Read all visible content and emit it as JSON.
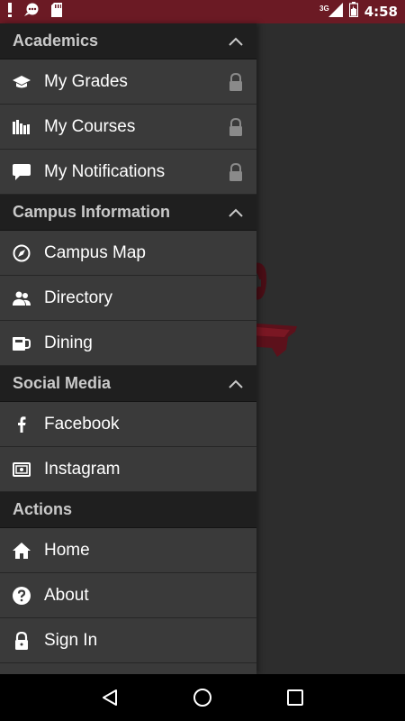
{
  "status_bar": {
    "time": "4:58",
    "network": "3G",
    "icons": [
      "alert-icon",
      "chat-icon",
      "sd-card-icon",
      "signal-icon",
      "battery-icon"
    ]
  },
  "drawer": {
    "sections": [
      {
        "title": "Academics",
        "collapsible": true,
        "items": [
          {
            "label": "My Grades",
            "icon": "graduation-cap-icon",
            "locked": true
          },
          {
            "label": "My Courses",
            "icon": "books-icon",
            "locked": true
          },
          {
            "label": "My Notifications",
            "icon": "speech-bubble-icon",
            "locked": true
          }
        ]
      },
      {
        "title": "Campus Information",
        "collapsible": true,
        "items": [
          {
            "label": "Campus Map",
            "icon": "compass-icon",
            "locked": false
          },
          {
            "label": "Directory",
            "icon": "people-icon",
            "locked": false
          },
          {
            "label": "Dining",
            "icon": "coffee-mug-icon",
            "locked": false
          }
        ]
      },
      {
        "title": "Social Media",
        "collapsible": true,
        "items": [
          {
            "label": "Facebook",
            "icon": "facebook-icon",
            "locked": false
          },
          {
            "label": "Instagram",
            "icon": "instagram-icon",
            "locked": false
          }
        ]
      },
      {
        "title": "Actions",
        "collapsible": false,
        "items": [
          {
            "label": "Home",
            "icon": "home-icon",
            "locked": false
          },
          {
            "label": "About",
            "icon": "help-circle-icon",
            "locked": false
          },
          {
            "label": "Sign In",
            "icon": "padlock-icon",
            "locked": false
          }
        ]
      }
    ]
  },
  "nav_bar": {
    "buttons": [
      "back-icon",
      "home-circle-icon",
      "recents-icon"
    ]
  },
  "colors": {
    "status_bar": "#6b1a24",
    "section_header": "#1f1f1f",
    "drawer_item": "#3a3a3a",
    "lock_icon": "#8a8a8a"
  }
}
